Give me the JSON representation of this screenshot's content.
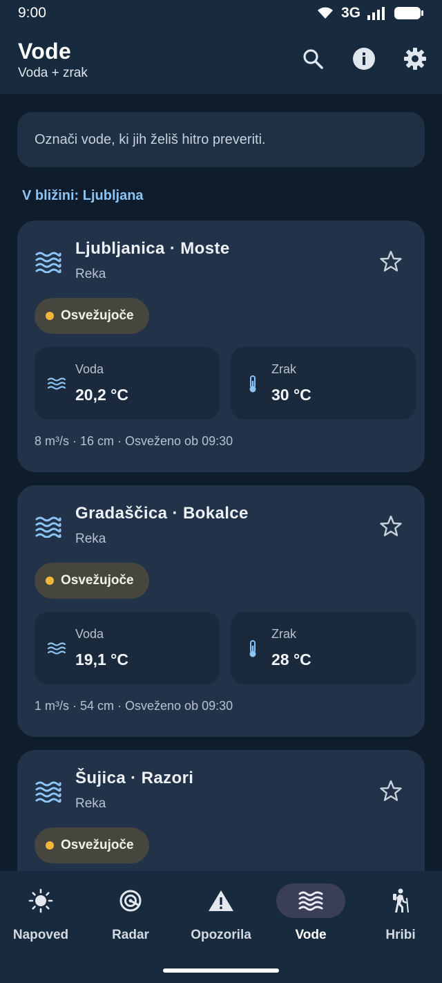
{
  "status": {
    "time": "9:00",
    "network": "3G"
  },
  "appbar": {
    "title": "Vode",
    "subtitle": "Voda + zrak"
  },
  "hint": "Označi vode, ki jih želiš hitro preveriti.",
  "section_label": "V bližini: Ljubljana",
  "cards": [
    {
      "name": "Ljubljanica · Moste",
      "type": "Reka",
      "badge": "Osvežujoče",
      "water_label": "Voda",
      "water_value": "20,2 °C",
      "air_label": "Zrak",
      "air_value": "30 °C",
      "footer": "8 m³/s · 16 cm · Osveženo ob 09:30"
    },
    {
      "name": "Gradaščica · Bokalce",
      "type": "Reka",
      "badge": "Osvežujoče",
      "water_label": "Voda",
      "water_value": "19,1 °C",
      "air_label": "Zrak",
      "air_value": "28 °C",
      "footer": "1 m³/s · 54 cm · Osveženo ob 09:30"
    },
    {
      "name": "Šujica · Razori",
      "type": "Reka",
      "badge": "Osvežujoče",
      "water_label": "Voda",
      "water_value": "",
      "air_label": "Zrak",
      "air_value": "",
      "footer": ""
    }
  ],
  "nav": [
    {
      "label": "Napoved",
      "icon": "sun-icon"
    },
    {
      "label": "Radar",
      "icon": "radar-icon"
    },
    {
      "label": "Opozorila",
      "icon": "warning-icon"
    },
    {
      "label": "Vode",
      "icon": "waves-icon",
      "active": true
    },
    {
      "label": "Hribi",
      "icon": "hiker-icon"
    }
  ],
  "colors": {
    "accent": "#8cc5f5",
    "badge_dot": "#f2b738",
    "card": "#223349",
    "background": "#0f1c2b"
  }
}
